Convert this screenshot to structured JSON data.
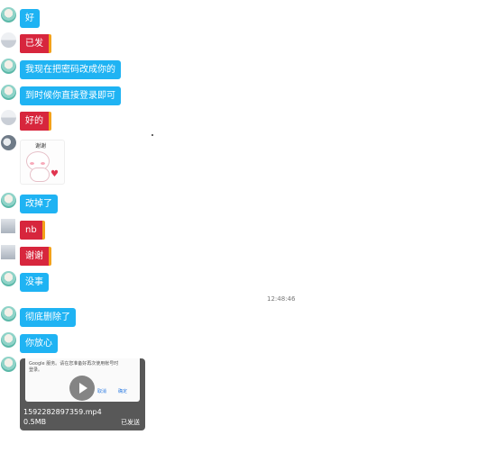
{
  "messages": [
    {
      "text": "好",
      "style": "blue",
      "avatar": "teal"
    },
    {
      "text": "已发",
      "style": "red",
      "avatar": "gray"
    },
    {
      "text": "我现在把密码改成你的",
      "style": "blue",
      "avatar": "teal"
    },
    {
      "text": "到时候你直接登录即可",
      "style": "blue",
      "avatar": "teal"
    },
    {
      "text": "好的",
      "style": "red",
      "avatar": "gray"
    },
    {
      "text": "改掉了",
      "style": "blue",
      "avatar": "teal"
    },
    {
      "text": "nb",
      "style": "red",
      "avatar": "square"
    },
    {
      "text": "谢谢",
      "style": "red",
      "avatar": "square"
    },
    {
      "text": "没事",
      "style": "blue",
      "avatar": "teal"
    },
    {
      "text": "彻底删除了",
      "style": "blue",
      "avatar": "teal"
    },
    {
      "text": "你放心",
      "style": "blue",
      "avatar": "teal"
    }
  ],
  "sticker": {
    "caption": "谢谢"
  },
  "timestamp": "12:48:46",
  "video": {
    "screenshot_text": "Google 服务。请在您准备好再次使用帐号时登录。",
    "screenshot_btn_1": "取消",
    "screenshot_btn_2": "确定",
    "filename": "1592282897359.mp4",
    "size": "0.5MB",
    "status": "已发送"
  },
  "colors": {
    "outgoing": "#1fb3f3",
    "incoming": "#d7263d",
    "incoming_accent": "#f3a21a"
  }
}
